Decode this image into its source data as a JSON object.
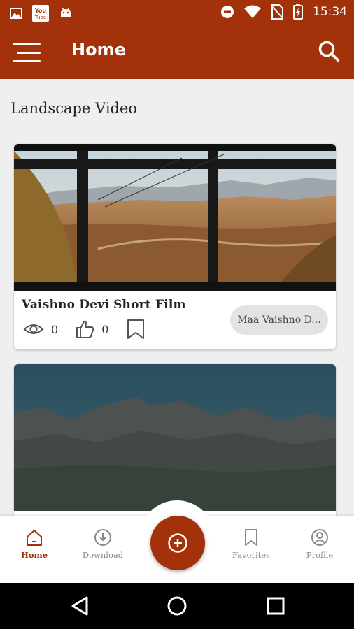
{
  "status_bar": {
    "time": "15:34",
    "notification_icons": [
      "image-icon",
      "youtube-app-icon",
      "android-icon"
    ],
    "system_icons": [
      "do-not-disturb-icon",
      "wifi-icon",
      "no-sim-icon",
      "battery-charging-icon"
    ]
  },
  "app_bar": {
    "title": "Home",
    "menu_icon": "hamburger-menu-icon",
    "search_icon": "search-icon",
    "color": "#a33109"
  },
  "section": {
    "title": "Landscape Video"
  },
  "videos": [
    {
      "title": "Vaishno Devi  Short Film",
      "views": "0",
      "likes": "0",
      "category": "Maa Vaishno D..."
    },
    {
      "title": "",
      "views": "",
      "likes": "",
      "category": ""
    }
  ],
  "bottom_nav": {
    "items": [
      {
        "label": "Home",
        "icon": "home-icon",
        "active": true
      },
      {
        "label": "Download",
        "icon": "download-icon",
        "active": false
      },
      {
        "label": "Favorites",
        "icon": "bookmark-icon",
        "active": false
      },
      {
        "label": "Profile",
        "icon": "profile-icon",
        "active": false
      }
    ],
    "fab_icon": "add-icon"
  },
  "android_nav": {
    "buttons": [
      "back-icon",
      "home-circle-icon",
      "recents-icon"
    ]
  }
}
